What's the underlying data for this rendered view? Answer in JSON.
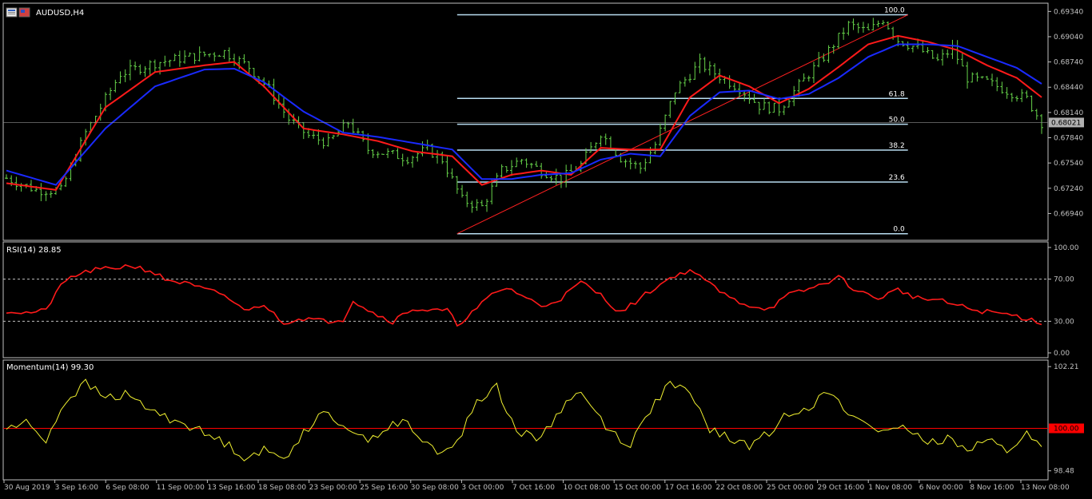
{
  "window": {
    "title": "AUDUSD,H4",
    "icon": "window-icon"
  },
  "colors": {
    "background": "#000000",
    "border": "#c0c0c0",
    "candle_up": "#66d24a",
    "ma_fast": "#ff1a1a",
    "ma_slow": "#1a2aff",
    "fib": "#b8dcf0",
    "trendline": "#ff2020",
    "rsi_line": "#ff1a1a",
    "momentum_line": "#f0f030",
    "momentum_level": "#ff0000",
    "price_tag_bg": "#b0b0b0",
    "momentum_tag_bg": "#ff0000",
    "axis_text": "#c0c0c0"
  },
  "chart_data": [
    {
      "type": "candlestick",
      "title": "AUDUSD,H4",
      "ylim": [
        0.6665,
        0.694
      ],
      "y_ticks": [
        "0.69340",
        "0.69040",
        "0.68740",
        "0.68440",
        "0.68140",
        "0.67840",
        "0.67540",
        "0.67240",
        "0.66940"
      ],
      "current_price": "0.68021",
      "close_path": [
        [
          0,
          0.6736
        ],
        [
          6,
          0.6722
        ],
        [
          11,
          0.6721
        ],
        [
          16,
          0.679
        ],
        [
          23,
          0.686
        ],
        [
          30,
          0.6873
        ],
        [
          37,
          0.688
        ],
        [
          44,
          0.6886
        ],
        [
          49,
          0.6868
        ],
        [
          53,
          0.6842
        ],
        [
          57,
          0.6806
        ],
        [
          61,
          0.6786
        ],
        [
          65,
          0.6778
        ],
        [
          69,
          0.6802
        ],
        [
          73,
          0.677
        ],
        [
          77,
          0.6765
        ],
        [
          81,
          0.676
        ],
        [
          85,
          0.677
        ],
        [
          88,
          0.6758
        ],
        [
          92,
          0.671
        ],
        [
          96,
          0.6702
        ],
        [
          100,
          0.6745
        ],
        [
          104,
          0.6758
        ],
        [
          108,
          0.6745
        ],
        [
          112,
          0.6735
        ],
        [
          116,
          0.6752
        ],
        [
          120,
          0.679
        ],
        [
          124,
          0.676
        ],
        [
          128,
          0.6748
        ],
        [
          131,
          0.6776
        ],
        [
          135,
          0.684
        ],
        [
          140,
          0.6872
        ],
        [
          144,
          0.6857
        ],
        [
          148,
          0.6843
        ],
        [
          152,
          0.6822
        ],
        [
          156,
          0.6818
        ],
        [
          160,
          0.6846
        ],
        [
          165,
          0.688
        ],
        [
          170,
          0.6918
        ],
        [
          174,
          0.691
        ],
        [
          177,
          0.6925
        ],
        [
          180,
          0.69
        ],
        [
          184,
          0.689
        ],
        [
          188,
          0.6875
        ],
        [
          191,
          0.689
        ],
        [
          194,
          0.6855
        ],
        [
          198,
          0.685
        ],
        [
          202,
          0.684
        ],
        [
          206,
          0.683
        ],
        [
          209,
          0.6802
        ]
      ],
      "series": [
        {
          "name": "",
          "kind": "ma_fast",
          "values": [
            [
              0,
              0.673
            ],
            [
              10,
              0.6722
            ],
            [
              20,
              0.682
            ],
            [
              30,
              0.6862
            ],
            [
              40,
              0.687
            ],
            [
              46,
              0.6874
            ],
            [
              52,
              0.6845
            ],
            [
              60,
              0.6795
            ],
            [
              68,
              0.6788
            ],
            [
              75,
              0.678
            ],
            [
              82,
              0.6768
            ],
            [
              90,
              0.6762
            ],
            [
              96,
              0.6728
            ],
            [
              102,
              0.674
            ],
            [
              108,
              0.6745
            ],
            [
              114,
              0.674
            ],
            [
              120,
              0.6772
            ],
            [
              126,
              0.677
            ],
            [
              132,
              0.677
            ],
            [
              138,
              0.6832
            ],
            [
              144,
              0.6858
            ],
            [
              150,
              0.6845
            ],
            [
              156,
              0.6825
            ],
            [
              162,
              0.6842
            ],
            [
              168,
              0.6868
            ],
            [
              174,
              0.6895
            ],
            [
              180,
              0.6905
            ],
            [
              186,
              0.6898
            ],
            [
              192,
              0.6888
            ],
            [
              198,
              0.687
            ],
            [
              204,
              0.6855
            ],
            [
              209,
              0.6832
            ]
          ]
        },
        {
          "name": "",
          "kind": "ma_slow",
          "values": [
            [
              0,
              0.6745
            ],
            [
              10,
              0.6728
            ],
            [
              20,
              0.6795
            ],
            [
              30,
              0.6845
            ],
            [
              40,
              0.6865
            ],
            [
              46,
              0.6866
            ],
            [
              52,
              0.685
            ],
            [
              60,
              0.6815
            ],
            [
              68,
              0.679
            ],
            [
              75,
              0.6785
            ],
            [
              82,
              0.6778
            ],
            [
              90,
              0.677
            ],
            [
              96,
              0.6735
            ],
            [
              102,
              0.6735
            ],
            [
              108,
              0.674
            ],
            [
              114,
              0.6742
            ],
            [
              120,
              0.6758
            ],
            [
              126,
              0.6765
            ],
            [
              132,
              0.6762
            ],
            [
              138,
              0.681
            ],
            [
              144,
              0.6838
            ],
            [
              150,
              0.684
            ],
            [
              156,
              0.683
            ],
            [
              162,
              0.6836
            ],
            [
              168,
              0.6855
            ],
            [
              174,
              0.688
            ],
            [
              180,
              0.6895
            ],
            [
              186,
              0.6895
            ],
            [
              192,
              0.6893
            ],
            [
              198,
              0.688
            ],
            [
              204,
              0.6867
            ],
            [
              209,
              0.6848
            ]
          ]
        }
      ],
      "fibonacci": {
        "start_x": 91,
        "end_x": 182,
        "low": 0.667,
        "high": 0.693,
        "levels": [
          {
            "label": "100.0",
            "ratio": 1.0
          },
          {
            "label": "61.8",
            "ratio": 0.618
          },
          {
            "label": "50.0",
            "ratio": 0.5
          },
          {
            "label": "38.2",
            "ratio": 0.382
          },
          {
            "label": "23.6",
            "ratio": 0.236
          },
          {
            "label": "0.0",
            "ratio": 0.0
          }
        ]
      },
      "trendline": {
        "x1": 91,
        "y1": 0.667,
        "x2": 182,
        "y2": 0.693
      }
    },
    {
      "type": "line",
      "title": "RSI(14) 28.85",
      "ylim": [
        0,
        100
      ],
      "y_ticks": [
        "100.00",
        "70.00",
        "30.00",
        "0.00"
      ],
      "levels": [
        70,
        30
      ],
      "series": [
        {
          "name": "RSI(14)",
          "values": [
            [
              0,
              40
            ],
            [
              4,
              38
            ],
            [
              8,
              40
            ],
            [
              10,
              58
            ],
            [
              13,
              72
            ],
            [
              17,
              78
            ],
            [
              21,
              80
            ],
            [
              25,
              83
            ],
            [
              29,
              78
            ],
            [
              32,
              70
            ],
            [
              36,
              66
            ],
            [
              40,
              60
            ],
            [
              44,
              55
            ],
            [
              48,
              40
            ],
            [
              50,
              45
            ],
            [
              53,
              42
            ],
            [
              56,
              29
            ],
            [
              60,
              33
            ],
            [
              64,
              30
            ],
            [
              68,
              32
            ],
            [
              70,
              50
            ],
            [
              74,
              38
            ],
            [
              78,
              30
            ],
            [
              82,
              42
            ],
            [
              86,
              40
            ],
            [
              89,
              40
            ],
            [
              91,
              27
            ],
            [
              94,
              38
            ],
            [
              98,
              55
            ],
            [
              101,
              62
            ],
            [
              104,
              55
            ],
            [
              108,
              44
            ],
            [
              112,
              52
            ],
            [
              116,
              67
            ],
            [
              120,
              55
            ],
            [
              124,
              38
            ],
            [
              128,
              52
            ],
            [
              131,
              62
            ],
            [
              135,
              74
            ],
            [
              139,
              78
            ],
            [
              142,
              65
            ],
            [
              146,
              52
            ],
            [
              150,
              45
            ],
            [
              154,
              42
            ],
            [
              158,
              55
            ],
            [
              163,
              62
            ],
            [
              168,
              72
            ],
            [
              172,
              58
            ],
            [
              176,
              52
            ],
            [
              180,
              60
            ],
            [
              184,
              52
            ],
            [
              188,
              50
            ],
            [
              192,
              45
            ],
            [
              196,
              40
            ],
            [
              200,
              38
            ],
            [
              204,
              35
            ],
            [
              209,
              28.85
            ]
          ]
        }
      ]
    },
    {
      "type": "line",
      "title": "Momentum(14) 99.30",
      "ylim": [
        98.3,
        102.3
      ],
      "y_ticks": [
        "102.21",
        "98.48"
      ],
      "level": 100.0,
      "level_label": "100.00",
      "series": [
        {
          "name": "Momentum(14)",
          "values": [
            [
              0,
              100.0
            ],
            [
              4,
              100.2
            ],
            [
              8,
              99.6
            ],
            [
              12,
              101.0
            ],
            [
              16,
              101.6
            ],
            [
              20,
              101.1
            ],
            [
              24,
              101.2
            ],
            [
              28,
              100.8
            ],
            [
              32,
              100.4
            ],
            [
              36,
              100.2
            ],
            [
              40,
              99.8
            ],
            [
              44,
              99.5
            ],
            [
              48,
              99.0
            ],
            [
              52,
              99.2
            ],
            [
              56,
              98.9
            ],
            [
              60,
              99.9
            ],
            [
              64,
              100.5
            ],
            [
              68,
              100.2
            ],
            [
              72,
              99.6
            ],
            [
              76,
              99.9
            ],
            [
              80,
              100.3
            ],
            [
              84,
              99.5
            ],
            [
              88,
              99.1
            ],
            [
              92,
              99.8
            ],
            [
              95,
              101.0
            ],
            [
              99,
              101.5
            ],
            [
              103,
              99.9
            ],
            [
              107,
              99.6
            ],
            [
              111,
              100.4
            ],
            [
              115,
              101.4
            ],
            [
              118,
              100.8
            ],
            [
              122,
              99.9
            ],
            [
              126,
              99.4
            ],
            [
              130,
              100.7
            ],
            [
              134,
              101.6
            ],
            [
              138,
              101.2
            ],
            [
              142,
              100.0
            ],
            [
              146,
              99.6
            ],
            [
              150,
              99.4
            ],
            [
              154,
              99.8
            ],
            [
              158,
              100.6
            ],
            [
              162,
              100.8
            ],
            [
              166,
              101.3
            ],
            [
              170,
              100.5
            ],
            [
              174,
              100.2
            ],
            [
              178,
              99.8
            ],
            [
              182,
              100.0
            ],
            [
              186,
              99.4
            ],
            [
              190,
              99.7
            ],
            [
              194,
              99.3
            ],
            [
              198,
              99.6
            ],
            [
              202,
              99.2
            ],
            [
              206,
              99.8
            ],
            [
              209,
              99.3
            ]
          ]
        }
      ]
    }
  ],
  "x_axis": {
    "labels": [
      "30 Aug 2019",
      "3 Sep 16:00",
      "6 Sep 08:00",
      "11 Sep 00:00",
      "13 Sep 16:00",
      "18 Sep 08:00",
      "23 Sep 00:00",
      "25 Sep 16:00",
      "30 Sep 08:00",
      "3 Oct 00:00",
      "7 Oct 16:00",
      "10 Oct 08:00",
      "15 Oct 00:00",
      "17 Oct 16:00",
      "22 Oct 08:00",
      "25 Oct 00:00",
      "29 Oct 16:00",
      "1 Nov 08:00",
      "6 Nov 00:00",
      "8 Nov 16:00",
      "13 Nov 08:00"
    ]
  }
}
